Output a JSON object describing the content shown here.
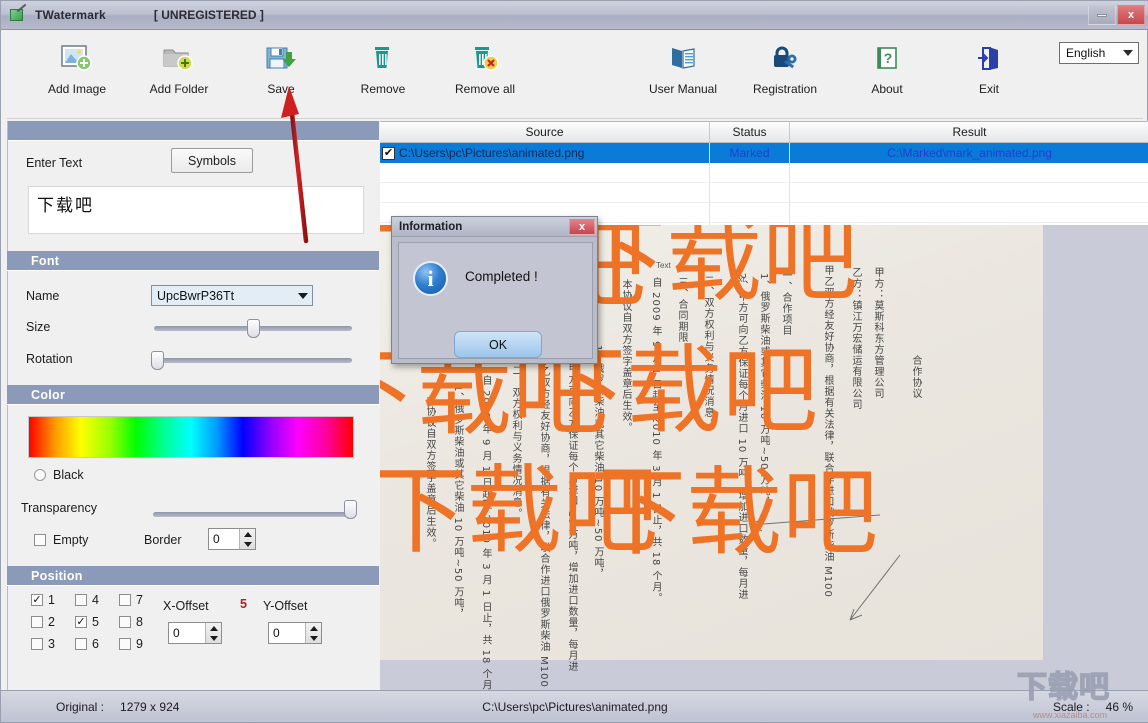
{
  "window": {
    "title": "TWatermark",
    "registration_state": "[ UNREGISTERED ]",
    "minimize_label": "",
    "close_label": "x",
    "app_icon": "watermark-doc-icon"
  },
  "toolbar": {
    "items": [
      {
        "label": "Add Image",
        "icon": "add-image-icon"
      },
      {
        "label": "Add Folder",
        "icon": "add-folder-icon"
      },
      {
        "label": "Save",
        "icon": "save-floppy-icon"
      },
      {
        "label": "Remove",
        "icon": "trash-icon"
      },
      {
        "label": "Remove all",
        "icon": "trash-delete-all-icon"
      },
      {
        "label": "User Manual",
        "icon": "book-icon"
      },
      {
        "label": "Registration",
        "icon": "lock-key-icon"
      },
      {
        "label": "About",
        "icon": "question-book-icon"
      },
      {
        "label": "Exit",
        "icon": "exit-door-icon"
      }
    ],
    "language": {
      "selected": "English",
      "options": [
        "English"
      ]
    }
  },
  "text_panel": {
    "enter_text_label": "Enter Text",
    "symbols_button": "Symbols",
    "text_value": "下载吧",
    "text_placeholder": ""
  },
  "font_panel": {
    "header": "Font",
    "name_label": "Name",
    "name_value": "UpcBwrP36Tt",
    "size_label": "Size",
    "size_percent": 47,
    "rotation_label": "Rotation",
    "rotation_percent": 0
  },
  "color_panel": {
    "header": "Color",
    "black_label": "Black",
    "black_selected": false,
    "transparency_label": "Transparency",
    "transparency_percent": 100,
    "empty_label": "Empty",
    "empty_checked": false,
    "border_label": "Border",
    "border_value": "0"
  },
  "position_panel": {
    "header": "Position",
    "cells": [
      {
        "label": "1",
        "checked": true
      },
      {
        "label": "4",
        "checked": false
      },
      {
        "label": "7",
        "checked": false
      },
      {
        "label": "2",
        "checked": false
      },
      {
        "label": "5",
        "checked": true
      },
      {
        "label": "8",
        "checked": false
      },
      {
        "label": "3",
        "checked": false
      },
      {
        "label": "6",
        "checked": false
      },
      {
        "label": "9",
        "checked": false
      }
    ],
    "x_offset_label": "X-Offset",
    "x_offset_value": "0",
    "y_offset_label": "Y-Offset",
    "y_offset_value": "0",
    "count_badge": "5"
  },
  "file_list": {
    "columns": [
      "Source",
      "Status",
      "Result"
    ],
    "rows": [
      {
        "checked": true,
        "checkmark": "✔",
        "source": "C:\\Users\\pc\\Pictures\\animated.png",
        "status": "Marked",
        "result": "C:\\Marked\\mark_animated.png",
        "selected": true
      }
    ],
    "empty_row_count": 4
  },
  "dialog": {
    "title": "Information",
    "close_label": "x",
    "icon": "info-icon",
    "icon_glyph": "i",
    "message": "Completed !",
    "ok_button": "OK"
  },
  "preview": {
    "watermark_text": "下载吧",
    "watermark_color": "#ee7326",
    "document_columns": [
      "合作协议",
      "甲方：莫斯科东方管理公司",
      "乙方：镇江万宏储运有限公司",
      "甲乙双方经友好协商，根据有关法律，联合作进口俄罗斯柴油 M100",
      "一、合作项目",
      "1、俄罗斯柴油或其它柴油 10 万吨~50 万吨，",
      "2、甲方可向乙方保证每个月进口 10 万吨，增加进口数量，每月进",
      "二、双方权利与义务情况消息。",
      "三、合同期限",
      "自 2009 年 9 月 1 日起至 2010 年 3 月 1 日止，共 18 个月。",
      "本协议自双方签字盖章后生效。"
    ],
    "inline_labels": [
      "Text",
      "Text"
    ]
  },
  "status_bar": {
    "original_label": "Original :",
    "original_value": "1279 x 924",
    "file_path": "C:\\Users\\pc\\Pictures\\animated.png",
    "scale_label": "Scale :",
    "scale_value": "46 %"
  },
  "site_watermark": {
    "logo_text": "下载吧",
    "url": "www.xiazaiba.com"
  },
  "colors": {
    "section_header": "#8a9ab8",
    "selection_blue": "#0a7bd6",
    "watermark_orange": "#ee7326",
    "annotation_red": "#c01a1a",
    "titlebar": "#b7bbcb"
  }
}
